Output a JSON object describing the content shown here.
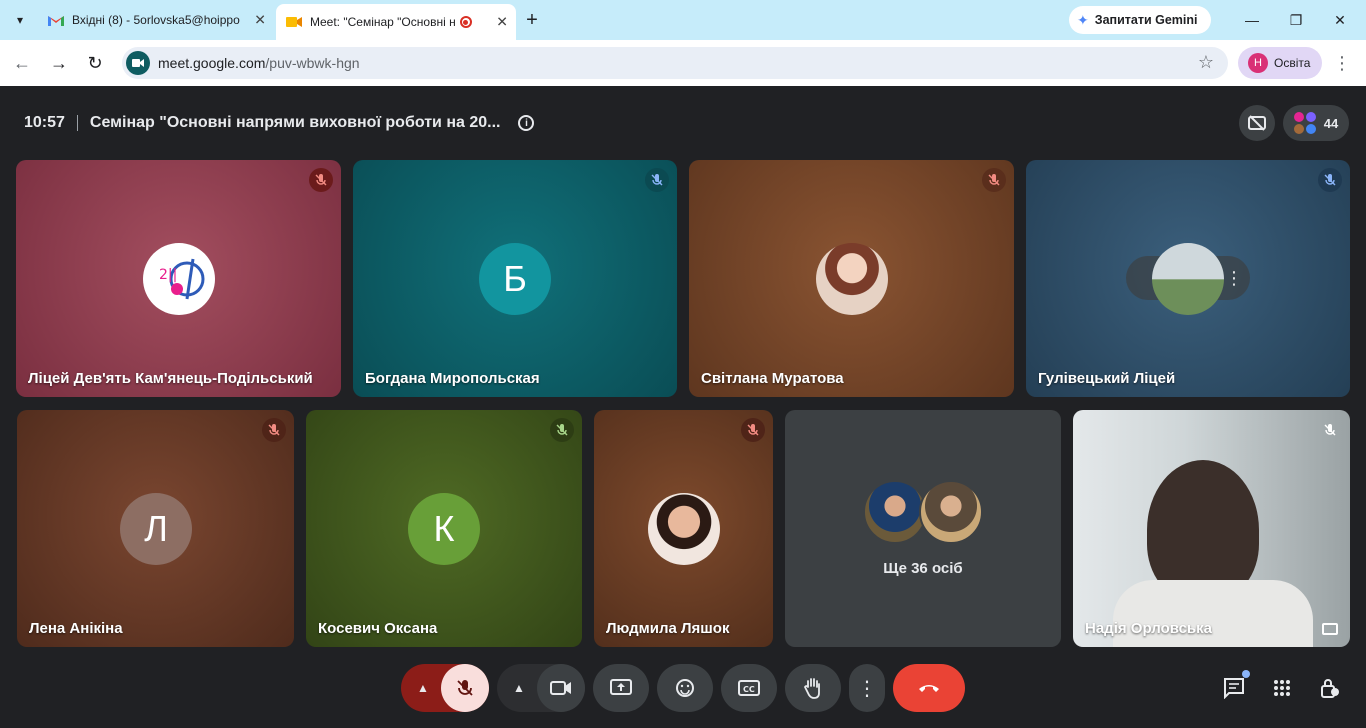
{
  "browser": {
    "tabs": [
      {
        "label": "Вхідні (8) - 5orlovska5@hoippo",
        "icon": "gmail-icon"
      },
      {
        "label": "Meet: \"Семінар \"Основні н",
        "icon": "meet-icon"
      }
    ],
    "gemini_label": "Запитати Gemini",
    "url_host": "meet.google.com",
    "url_path": "/puv-wbwk-hgn",
    "profile_initial": "Н",
    "profile_name": "Освіта"
  },
  "meeting": {
    "time": "10:57",
    "title": "Семінар \"Основні напрями виховної роботи на 20...",
    "participant_count": "44"
  },
  "tiles": [
    {
      "name": "Ліцей Дев'ять Кам'янець-Подільський",
      "initial": "",
      "bg": "#8a3b4d"
    },
    {
      "name": "Богдана Миропольская",
      "initial": "Б",
      "bg": "#0b5560"
    },
    {
      "name": "Світлана Муратова",
      "initial": "",
      "bg": "#6d4125"
    },
    {
      "name": "Гулівецький Ліцей",
      "initial": "",
      "bg": "#2c4a62"
    },
    {
      "name": "Лена Анікіна",
      "initial": "Л",
      "bg": "#5c3322"
    },
    {
      "name": "Косевич Оксана",
      "initial": "К",
      "bg": "#3d4f1d"
    },
    {
      "name": "Людмила Ляшок",
      "initial": "",
      "bg": "#633722"
    },
    {
      "name": "Ще 36 осіб",
      "initial": "",
      "bg": "#3c4043"
    },
    {
      "name": "Надія Орловська",
      "initial": "",
      "bg": "#c9cdd0"
    }
  ],
  "overflow_label": "Ще 36 осіб",
  "colors": {
    "accent_red": "#ea4335",
    "meet_bg": "#202124",
    "control_bg": "#3c4043"
  }
}
